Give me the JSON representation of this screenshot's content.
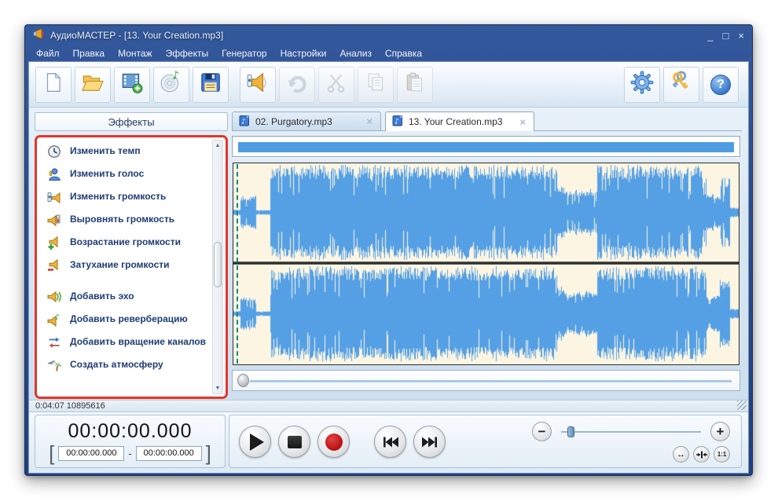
{
  "window": {
    "title": "АудиоМАСТЕР - [13. Your Creation.mp3]",
    "controls": {
      "minimize": "_",
      "maximize": "□",
      "close": "×"
    }
  },
  "menu": {
    "items": [
      "Файл",
      "Правка",
      "Монтаж",
      "Эффекты",
      "Генератор",
      "Настройки",
      "Анализ",
      "Справка"
    ]
  },
  "toolbar": {
    "main": [
      {
        "id": "new-file",
        "icon": "new-file",
        "disabled": false
      },
      {
        "id": "open-file",
        "icon": "open-folder",
        "disabled": false
      },
      {
        "id": "import-video",
        "icon": "film-plus",
        "disabled": false
      },
      {
        "id": "grab-cd",
        "icon": "cd-note",
        "disabled": false
      },
      {
        "id": "save-file",
        "icon": "floppy",
        "disabled": false
      },
      {
        "id": "sep-1",
        "separator": true
      },
      {
        "id": "volume-mixer",
        "icon": "speaker-slider",
        "disabled": false
      },
      {
        "id": "undo",
        "icon": "undo-arrow",
        "disabled": true
      },
      {
        "id": "cut",
        "icon": "scissors",
        "disabled": true
      },
      {
        "id": "copy",
        "icon": "copy-pages",
        "disabled": true
      },
      {
        "id": "paste",
        "icon": "paste-clipboard",
        "disabled": true
      }
    ],
    "right": [
      {
        "id": "settings",
        "icon": "gear",
        "disabled": false
      },
      {
        "id": "license-key",
        "icon": "key",
        "disabled": false
      },
      {
        "id": "help",
        "icon": "question",
        "disabled": false
      }
    ]
  },
  "sidebar": {
    "header": "Эффекты",
    "effects": [
      {
        "id": "change-tempo",
        "icon": "clock",
        "label": "Изменить темп"
      },
      {
        "id": "change-voice",
        "icon": "voice",
        "label": "Изменить голос"
      },
      {
        "id": "change-volume",
        "icon": "volume",
        "label": "Изменить громкость"
      },
      {
        "id": "normalize",
        "icon": "normalize",
        "label": "Выровнять громкость"
      },
      {
        "id": "fade-in",
        "icon": "fade-in",
        "label": "Возрастание громкости"
      },
      {
        "id": "fade-out",
        "icon": "fade-out",
        "label": "Затухание громкости"
      },
      {
        "id": "add-echo",
        "icon": "echo",
        "label": "Добавить эхо",
        "gap_before": true
      },
      {
        "id": "add-reverb",
        "icon": "reverb",
        "label": "Добавить реверберацию"
      },
      {
        "id": "channel-rotation",
        "icon": "rotation",
        "label": "Добавить вращение каналов"
      },
      {
        "id": "create-atmosphere",
        "icon": "atmosphere",
        "label": "Создать атмосферу"
      }
    ]
  },
  "tabs": [
    {
      "id": "tab-purgatory",
      "label": "02. Purgatory.mp3",
      "close": "×",
      "active": false
    },
    {
      "id": "tab-your-creation",
      "label": "13. Your Creation.mp3",
      "close": "×",
      "active": true
    }
  ],
  "waveform": {
    "channels": 2,
    "color": "#55a0e5",
    "background": "#fcf5e2",
    "cursor_color": "#128a86",
    "overview_color": "#4f9ce0",
    "segments": [
      [
        0.0,
        0.013,
        0.06
      ],
      [
        0.013,
        0.045,
        0.34
      ],
      [
        0.045,
        0.072,
        0.05
      ],
      [
        0.072,
        0.64,
        0.97
      ],
      [
        0.64,
        0.655,
        0.55
      ],
      [
        0.655,
        0.72,
        0.46
      ],
      [
        0.72,
        0.935,
        0.97
      ],
      [
        0.935,
        0.962,
        0.38
      ],
      [
        0.962,
        0.982,
        0.72
      ],
      [
        0.982,
        1.0,
        0.1
      ]
    ]
  },
  "statusbar": {
    "text": "0:04:07 10895616"
  },
  "transport": {
    "time": "00:00:00.000",
    "range_open": "[",
    "range_start": "00:00:00.000",
    "range_separator": "-",
    "range_end": "00:00:00.000",
    "range_close": "]"
  },
  "controls": {
    "zoom_out": "−",
    "zoom_in": "+",
    "fit_width": "↔",
    "one_to_one": "1:1"
  }
}
